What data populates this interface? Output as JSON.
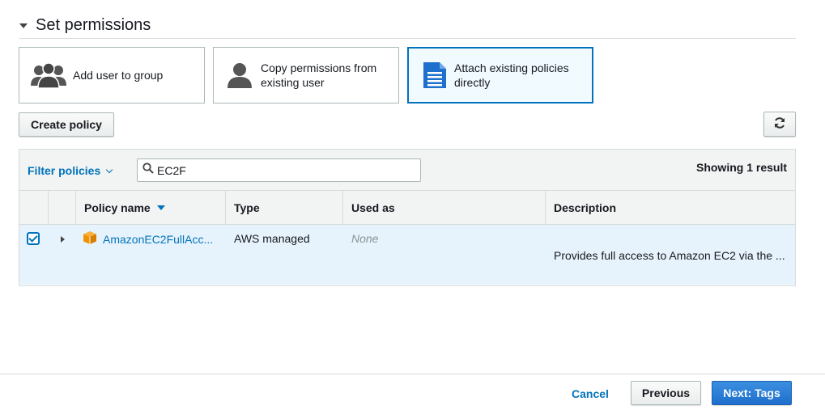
{
  "section": {
    "title": "Set permissions"
  },
  "options": [
    {
      "label": "Add user to group",
      "icon": "group-icon"
    },
    {
      "label": "Copy permissions from existing user",
      "icon": "user-icon"
    },
    {
      "label": "Attach existing policies directly",
      "icon": "document-icon"
    }
  ],
  "toolbar": {
    "create_policy_label": "Create policy",
    "refresh_icon": "refresh-icon"
  },
  "filter": {
    "label": "Filter policies",
    "search_value": "EC2F",
    "result_text": "Showing 1 result"
  },
  "table": {
    "columns": [
      "Policy name",
      "Type",
      "Used as",
      "Description"
    ],
    "rows": [
      {
        "checked": true,
        "policy_name": "AmazonEC2FullAcc...",
        "type": "AWS managed",
        "used_as": "None",
        "description": "Provides full access to Amazon EC2 via the ..."
      }
    ]
  },
  "footer": {
    "cancel_label": "Cancel",
    "previous_label": "Previous",
    "next_label": "Next: Tags"
  },
  "colors": {
    "accent": "#0073bb",
    "selected_bg": "#f1faff",
    "row_bg": "#e7f3fc",
    "primary_button": "#1f6fcc",
    "policy_icon": "#f29100"
  }
}
